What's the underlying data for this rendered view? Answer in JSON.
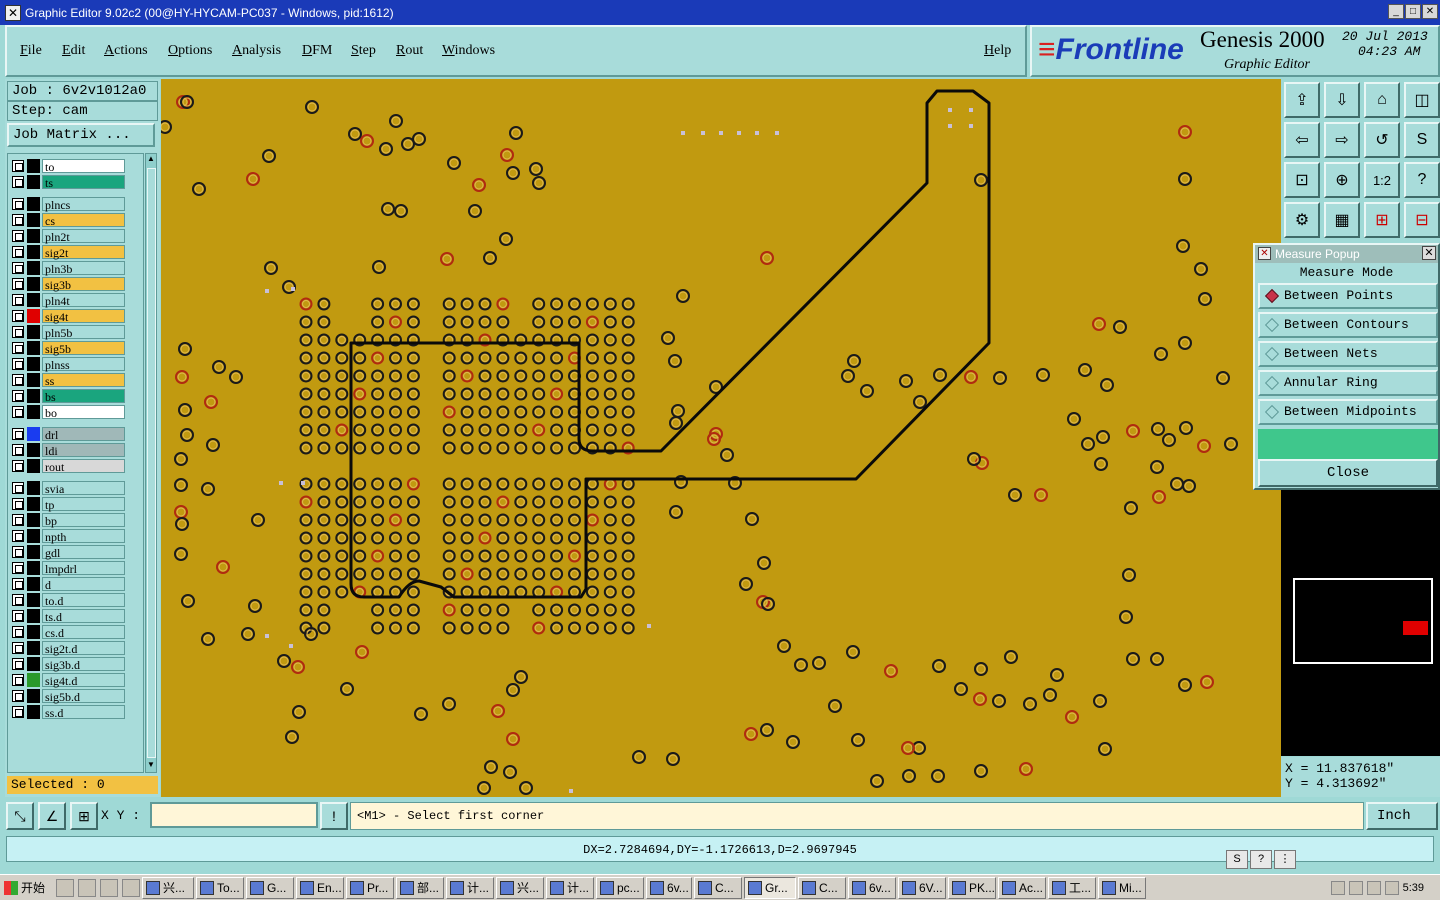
{
  "window": {
    "title": "Graphic Editor 9.02c2 (00@HY-HYCAM-PC037 - Windows, pid:1612)",
    "buttons": [
      "minimize",
      "maximize",
      "close"
    ]
  },
  "menu": {
    "items": [
      "File",
      "Edit",
      "Actions",
      "Options",
      "Analysis",
      "DFM",
      "Step",
      "Rout",
      "Windows"
    ],
    "help": "Help"
  },
  "brand": {
    "logo": "Frontline",
    "product": "Genesis 2000",
    "subtitle": "Graphic Editor",
    "date": "20 Jul 2013",
    "time": "04:23 AM"
  },
  "job": {
    "job_label": "Job : 6v2v1012a0",
    "step_label": "Step: cam",
    "matrix_button": "Job Matrix ..."
  },
  "layers": [
    {
      "name": "to",
      "color": "#ffffff",
      "swatch": "#000000"
    },
    {
      "name": "ts",
      "color": "#1aa57e",
      "swatch": "#000000"
    },
    {
      "name": "plncs",
      "color": "#a8dcda",
      "swatch": "#000000"
    },
    {
      "name": "cs",
      "color": "#f2c142",
      "swatch": "#000000"
    },
    {
      "name": "pln2t",
      "color": "#a8dcda",
      "swatch": "#000000"
    },
    {
      "name": "sig2t",
      "color": "#f2c142",
      "swatch": "#000000"
    },
    {
      "name": "pln3b",
      "color": "#a8dcda",
      "swatch": "#000000"
    },
    {
      "name": "sig3b",
      "color": "#f2c142",
      "swatch": "#000000"
    },
    {
      "name": "pln4t",
      "color": "#a8dcda",
      "swatch": "#000000"
    },
    {
      "name": "sig4t",
      "color": "#f2c142",
      "swatch": "#e00000"
    },
    {
      "name": "pln5b",
      "color": "#a8dcda",
      "swatch": "#000000"
    },
    {
      "name": "sig5b",
      "color": "#f2c142",
      "swatch": "#000000"
    },
    {
      "name": "plnss",
      "color": "#a8dcda",
      "swatch": "#000000"
    },
    {
      "name": "ss",
      "color": "#f2c142",
      "swatch": "#000000"
    },
    {
      "name": "bs",
      "color": "#1aa57e",
      "swatch": "#000000"
    },
    {
      "name": "bo",
      "color": "#ffffff",
      "swatch": "#000000"
    },
    {
      "name": "drl",
      "color": "#a0b8b8",
      "swatch": "#1a3cf0"
    },
    {
      "name": "ldi",
      "color": "#a0b8b8",
      "swatch": "#000000"
    },
    {
      "name": "rout",
      "color": "#d8d8d8",
      "swatch": "#000000"
    },
    {
      "name": "svia",
      "color": "#a8dcda",
      "swatch": "#000000"
    },
    {
      "name": "tp",
      "color": "#a8dcda",
      "swatch": "#000000"
    },
    {
      "name": "bp",
      "color": "#a8dcda",
      "swatch": "#000000"
    },
    {
      "name": "npth",
      "color": "#a8dcda",
      "swatch": "#000000"
    },
    {
      "name": "gdl",
      "color": "#a8dcda",
      "swatch": "#000000"
    },
    {
      "name": "lmpdrl",
      "color": "#a8dcda",
      "swatch": "#000000"
    },
    {
      "name": "d",
      "color": "#a8dcda",
      "swatch": "#000000"
    },
    {
      "name": "to.d",
      "color": "#a8dcda",
      "swatch": "#000000"
    },
    {
      "name": "ts.d",
      "color": "#a8dcda",
      "swatch": "#000000"
    },
    {
      "name": "cs.d",
      "color": "#a8dcda",
      "swatch": "#000000"
    },
    {
      "name": "sig2t.d",
      "color": "#a8dcda",
      "swatch": "#000000"
    },
    {
      "name": "sig3b.d",
      "color": "#a8dcda",
      "swatch": "#000000"
    },
    {
      "name": "sig4t.d",
      "color": "#a8dcda",
      "swatch": "#2a9a2a"
    },
    {
      "name": "sig5b.d",
      "color": "#a8dcda",
      "swatch": "#000000"
    },
    {
      "name": "ss.d",
      "color": "#a8dcda",
      "swatch": "#000000"
    }
  ],
  "selected": "Selected : 0",
  "measure_popup": {
    "title": "Measure Popup",
    "mode_label": "Measure Mode",
    "options": [
      "Between Points",
      "Between Contours",
      "Between Nets",
      "Annular Ring",
      "Between Midpoints"
    ],
    "selected_option": "Between Points",
    "close_label": "Close"
  },
  "coords": {
    "x": "X = 11.837618\"",
    "y": "Y = 4.313692\""
  },
  "status": {
    "xy_label": "X Y :",
    "xy_value": "",
    "prompt": "<M1> - Select first corner",
    "units": "Inch"
  },
  "measurement": "DX=2.7284694,DY=-1.1726613,D=2.9697945",
  "taskbar": {
    "start": "开始",
    "tasks": [
      "兴...",
      "To...",
      "G...",
      "En...",
      "Pr...",
      "部...",
      "计...",
      "兴...",
      "计...",
      "pc...",
      "6v...",
      "C...",
      "Gr...",
      "C...",
      "6v...",
      "6V...",
      "PK...",
      "Ac...",
      "工...",
      "Mi..."
    ],
    "active_task": "Gr...",
    "clock": "5:39"
  },
  "colors": {
    "board": "#c19a10",
    "panel": "#a8dcda",
    "titlebar": "#1a3ab8",
    "trace": "#0a0a0a",
    "pad_ring": "#1a1a1a"
  }
}
